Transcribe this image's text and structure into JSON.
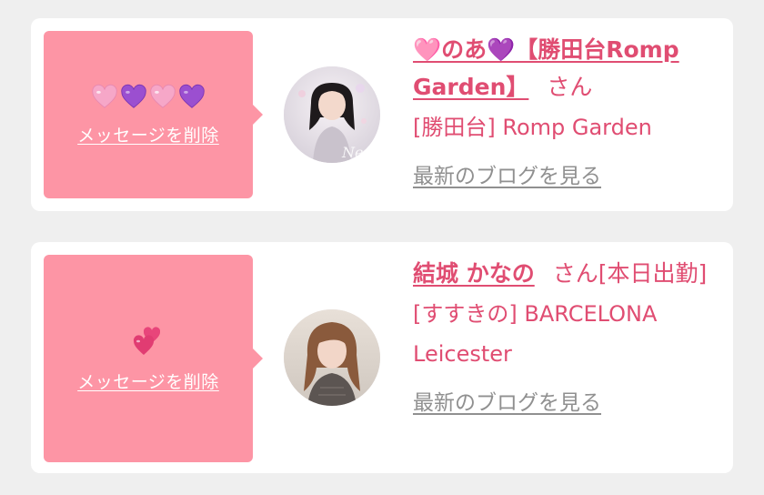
{
  "messages": [
    {
      "decor_emojis": [
        "pink-heart",
        "purple-heart",
        "pink-heart",
        "purple-heart"
      ],
      "delete_label": "メッセージを削除",
      "name": "🩷のあ💜【勝田台Romp Garden】",
      "suffix": "さん",
      "shop": "[勝田台] Romp Garden",
      "blog_link": "最新のブログを見る",
      "avatar_caption": "Nea"
    },
    {
      "decor_emojis": [
        "two-hearts"
      ],
      "delete_label": "メッセージを削除",
      "name": "結城 かなの",
      "suffix": "さん[本日出勤]",
      "shop": "[すすきの] BARCELONA Leicester",
      "blog_link": "最新のブログを見る"
    }
  ],
  "colors": {
    "accent": "#e04d72",
    "delete_box": "#fd95a5",
    "blog_link": "#909090",
    "background": "#efefef"
  }
}
